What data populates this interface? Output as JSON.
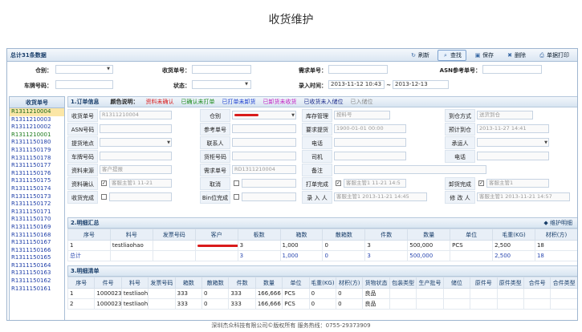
{
  "page_title": "收货维护",
  "header": {
    "total_label": "总计31条数据"
  },
  "toolbar": {
    "refresh": "刷新",
    "search": "查找",
    "save": "保存",
    "delete": "删除",
    "print": "单据打印"
  },
  "search": {
    "warehouse_label": "仓别：",
    "receipt_no_label": "收货单号：",
    "demand_no_label": "需求单号：",
    "asn_ref_label": "ASN参考单号：",
    "vehicle_no_label": "车牌号码：",
    "status_label": "状态：",
    "entry_time_label": "录入时间：",
    "date_from": "2013-11-12 10:43",
    "date_to": "2013-12-13",
    "date_sep": "~"
  },
  "sidebar": {
    "header": "收货单号",
    "items": [
      "R1311210004",
      "R1311210003",
      "R1311210002",
      "R1311210001",
      "R1311150180",
      "R1311150179",
      "R1311150178",
      "R1311150177",
      "R1311150176",
      "R1311150175",
      "R1311150174",
      "R1311150173",
      "R1311150172",
      "R1311150171",
      "R1311150170",
      "R1311150169",
      "R1311150168",
      "R1311150167",
      "R1311150166",
      "R1311150165",
      "R1311150164",
      "R1311150163",
      "R1311150162",
      "R1311150161"
    ]
  },
  "order": {
    "section_title": "1.订单信息",
    "legend_title": "颜色说明：",
    "legend": [
      {
        "label": "资料未确认",
        "color": "#d91b1b"
      },
      {
        "label": "已确认未打单",
        "color": "#1a8a1a"
      },
      {
        "label": "已打单未卸货",
        "color": "#1b3fd0"
      },
      {
        "label": "已卸货未收货",
        "color": "#c21fc2"
      },
      {
        "label": "已收货未入储位",
        "color": "#1a2a8a"
      },
      {
        "label": "已入储位",
        "color": "#888888"
      }
    ],
    "labels": {
      "receipt_no": "收货单号",
      "warehouse": "仓别",
      "stock_mgmt": "库存管理",
      "arrival_mode": "到仓方式",
      "asn_no": "ASN号码",
      "ref_no": "参考单号",
      "req_delivery": "要求提货",
      "est_arrival": "预计到仓",
      "pickup_place": "提货地点",
      "contact": "联系人",
      "phone1": "电话",
      "carrier": "承运人",
      "vehicle_no": "车牌号码",
      "cabinet_no": "货柜号码",
      "driver": "司机",
      "phone2": "电话",
      "data_source": "资料来源",
      "demand_no": "需求单号",
      "remark": "备注",
      "data_confirm": "资料确认",
      "cancel": "取消",
      "print_done": "打单完成",
      "unload_done": "卸货完成",
      "receive_done": "收货完成",
      "bin_done": "Bin位完成",
      "entry_by": "录 入 人",
      "modified_by": "修 改 人"
    },
    "values": {
      "receipt_no": "R1311210004",
      "stock_mgmt": "按料号",
      "arrival_mode": "送货到仓",
      "req_delivery": "1900-01-01 00:00",
      "est_arrival": "2013-11-27 14:41",
      "data_source": "客户提报",
      "demand_no": "RD1311210004",
      "data_confirm": "客服主管1 11-21",
      "print_done": "客服主管1 11-21 14:5",
      "unload_done": "客服主管1",
      "entry_by": "客服主管1 2013-11-21 14:45",
      "modified_by": "客服主管1 2013-11-21 14:57"
    }
  },
  "summary": {
    "section_title": "2.明细汇总",
    "action": "维护明细",
    "columns": [
      "序号",
      "料号",
      "发票号码",
      "客户",
      "板数",
      "箱数",
      "散箱数",
      "件数",
      "数量",
      "单位",
      "毛重(KG)",
      "材积(方)"
    ],
    "rows": [
      [
        "1",
        "testliaohao",
        "",
        "",
        "3",
        "1,000",
        "0",
        "3",
        "500,000",
        "PCS",
        "2,500",
        "18"
      ]
    ],
    "total_row": [
      "总计",
      "",
      "",
      "",
      "3",
      "1,000",
      "0",
      "3",
      "500,000",
      "",
      "2,500",
      "18"
    ]
  },
  "detail": {
    "section_title": "3.明细清单",
    "columns": [
      "序号",
      "件号",
      "料号",
      "发票号码",
      "箱数",
      "散箱数",
      "件数",
      "数量",
      "单位",
      "毛重(KG)",
      "材积(方)",
      "货物状态",
      "包装类型",
      "生产批号",
      "储位",
      "原件号",
      "原件类型",
      "合件号",
      "合件类型"
    ],
    "rows": [
      [
        "1",
        "100002330001",
        "testliaohao",
        "",
        "333",
        "0",
        "333",
        "166,666",
        "PCS",
        "0",
        "0",
        "良品",
        "",
        "",
        "",
        "",
        "",
        "",
        ""
      ],
      [
        "2",
        "100002330002",
        "testliaohao",
        "",
        "333",
        "0",
        "333",
        "166,666",
        "PCS",
        "0",
        "0",
        "良品",
        "",
        "",
        "",
        "",
        "",
        "",
        ""
      ]
    ]
  },
  "footer": "深圳杰众科技有限公司©版权所有  服务热线：0755-29373909"
}
